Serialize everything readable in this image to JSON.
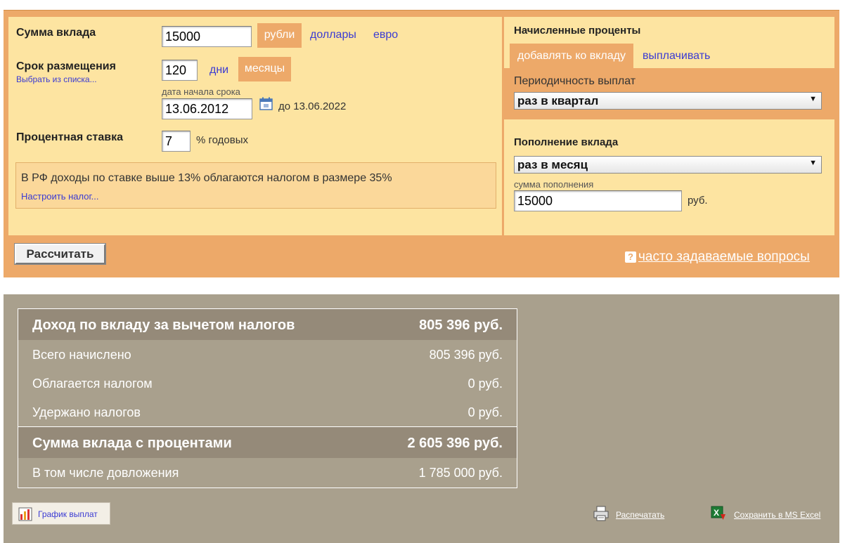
{
  "calc": {
    "deposit_label": "Сумма вклада",
    "deposit_value": "15000",
    "currencies": [
      "рубли",
      "доллары",
      "евро"
    ],
    "term_label": "Срок размещения",
    "term_pick_link": "Выбрать из списка...",
    "term_value": "120",
    "term_units": [
      "дни",
      "месяцы"
    ],
    "start_date_label": "дата начала срока",
    "start_date_value": "13.06.2012",
    "end_date_text": "до 13.06.2022",
    "rate_label": "Процентная ставка",
    "rate_value": "7",
    "rate_unit": "% годовых",
    "tax_note": "В РФ доходы по ставке выше 13% облагаются налогом в размере 35%",
    "tax_link": "Настроить налог...",
    "calc_button": "Рассчитать",
    "faq_link": "часто задаваемые вопросы"
  },
  "interest": {
    "title": "Начисленные проценты",
    "tabs": [
      "добавлять ко вкладу",
      "выплачивать"
    ],
    "period_label": "Периодичность выплат",
    "period_value": "раз в квартал",
    "topup_title": "Пополнение вклада",
    "topup_value": "раз в месяц",
    "topup_amount_label": "сумма пополнения",
    "topup_amount_value": "15000",
    "topup_unit": "руб."
  },
  "results": {
    "rows": [
      {
        "label": "Доход по вкладу за вычетом налогов",
        "value": "805 396 руб."
      },
      {
        "label": "Всего начислено",
        "value": "805 396 руб."
      },
      {
        "label": "Облагается налогом",
        "value": "0 руб."
      },
      {
        "label": "Удержано налогов",
        "value": "0 руб."
      },
      {
        "label": "Сумма вклада с процентами",
        "value": "2 605 396 руб."
      },
      {
        "label": "В том числе довложения",
        "value": "1 785 000 руб."
      }
    ],
    "chart_button": "График выплат",
    "print_link": "Распечатать",
    "excel_link": "Сохранить в MS Excel"
  },
  "colors": {
    "accent": "#eda969",
    "panel": "#fde4a1",
    "results_bg": "#a9a08d",
    "results_header": "#958a79",
    "link": "#3b3bd3"
  }
}
